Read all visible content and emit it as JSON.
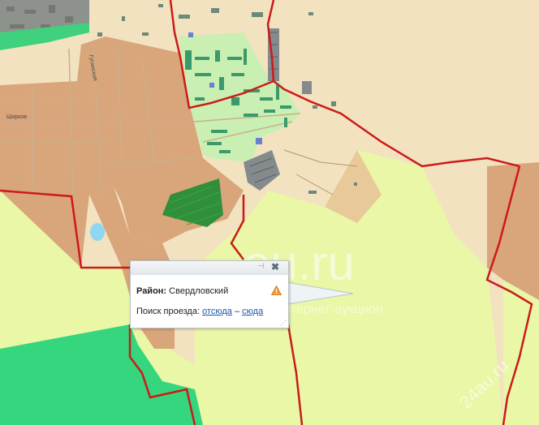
{
  "map": {
    "colors": {
      "background": "#f2e2c0",
      "urban": "#d9a57a",
      "meadow": "#e9f7a6",
      "residential": "#c9efb3",
      "forest": "#35d67e",
      "forest_dark": "#2f8f3a",
      "boundary": "#cc1a1a",
      "water": "#8fd6f0",
      "road": "#c9b08c"
    },
    "labels": {
      "street_a": "Ширков",
      "street_b": "Гусинская"
    }
  },
  "popup": {
    "district_label": "Район:",
    "district_value": "Свердловский",
    "route_label": "Поиск проезда:",
    "route_from": "отсюда",
    "route_sep": "–",
    "route_to": "сюда"
  },
  "watermarks": {
    "site": "eu.ru",
    "caption": "интернет-аукцион",
    "corner": "24au.ru"
  }
}
